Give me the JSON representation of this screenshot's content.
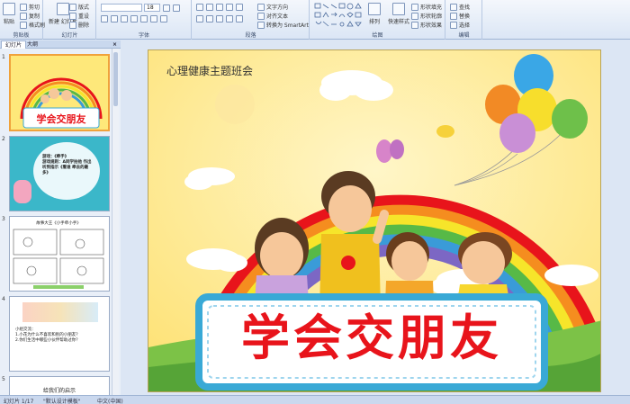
{
  "ribbon": {
    "clipboard": {
      "paste": "粘贴",
      "cut": "剪切",
      "copy": "复制",
      "format_painter": "格式刷",
      "label": "剪贴板"
    },
    "slides": {
      "new_slide": "新建\n幻灯片",
      "layout": "版式",
      "reset": "重设",
      "delete": "删除",
      "label": "幻灯片"
    },
    "font": {
      "font_name": "",
      "font_size": "18",
      "label": "字体"
    },
    "paragraph": {
      "label": "段落",
      "text_direction": "文字方向",
      "align_text": "对齐文本",
      "smartart": "转换为 SmartArt"
    },
    "drawing": {
      "arrange": "排列",
      "quick_styles": "快速样式",
      "shape_fill": "形状填充",
      "shape_outline": "形状轮廓",
      "shape_effects": "形状效果",
      "label": "绘图"
    },
    "editing": {
      "find": "查找",
      "replace": "替换",
      "select": "选择",
      "label": "编辑"
    }
  },
  "panes": {
    "tab_slides": "幻灯片",
    "tab_outline": "大纲"
  },
  "thumbs": [
    {
      "num": "1",
      "title": "学会交朋友"
    },
    {
      "num": "2",
      "text": "游戏：《牵手》\n游戏规则：A同学拍他 作出听到指示《看谁 牵去的最多》"
    },
    {
      "num": "3",
      "text": "故事大王《小手牵小手》"
    },
    {
      "num": "4",
      "text": "小组交流：\n1.小花为什么不喜欢和别的小朋友？\n2.你们生活中哪些小伙伴帮助过你？"
    },
    {
      "num": "5",
      "text": "给我们的启示"
    }
  ],
  "slide": {
    "subtitle": "心理健康主题班会",
    "title": "学会交朋友"
  },
  "status": {
    "slide_count": "幻灯片 1/17",
    "theme": "\"默认设计模板\"",
    "language": "中文(中国)"
  },
  "colors": {
    "title_red": "#e8141b",
    "slide_bg": "#fee87a",
    "banner_border": "#39a9d6"
  }
}
